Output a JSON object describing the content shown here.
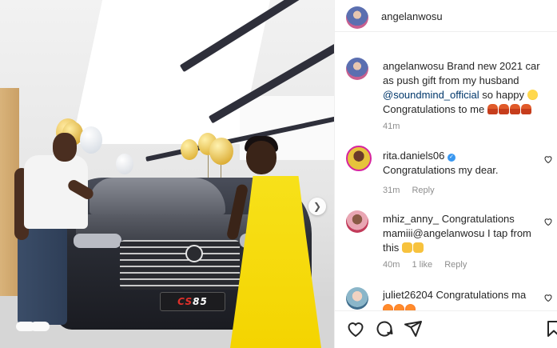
{
  "post": {
    "author": "angelanwosu",
    "image_carousel_next": "next"
  },
  "car_plate": {
    "prefix": "CS",
    "suffix": "85"
  },
  "caption": {
    "username": "angelanwosu",
    "text_before": "Brand new 2021 car as push gift from my husband",
    "mention": "@soundmind_official",
    "text_after": "so happy",
    "line2": "Congratulations to me",
    "emoji_after_happy": "grinning-face",
    "emoji_trail": [
      "person",
      "person",
      "person",
      "person"
    ],
    "time": "41m"
  },
  "comments": [
    {
      "username": "rita.daniels06",
      "verified": true,
      "text": "Congratulations my dear.",
      "time": "31m",
      "reply_label": "Reply"
    },
    {
      "username": "mhiz_anny_",
      "text": "Congratulations mamiii@angelanwosu I tap from this",
      "emojis": [
        "hands",
        "hands-raised"
      ],
      "time": "40m",
      "likes_label": "1 like",
      "reply_label": "Reply"
    },
    {
      "username": "juliet26204",
      "text": "Congratulations ma",
      "emojis": [
        "face",
        "face",
        "face"
      ]
    }
  ],
  "actions": {
    "like": "heart-icon",
    "comment": "comment-icon",
    "share": "share-icon",
    "save": "bookmark-icon"
  },
  "colors": {
    "mention": "#00376b",
    "meta": "#8e8e8e",
    "verified": "#3897f0",
    "dress": "#f4d400"
  }
}
